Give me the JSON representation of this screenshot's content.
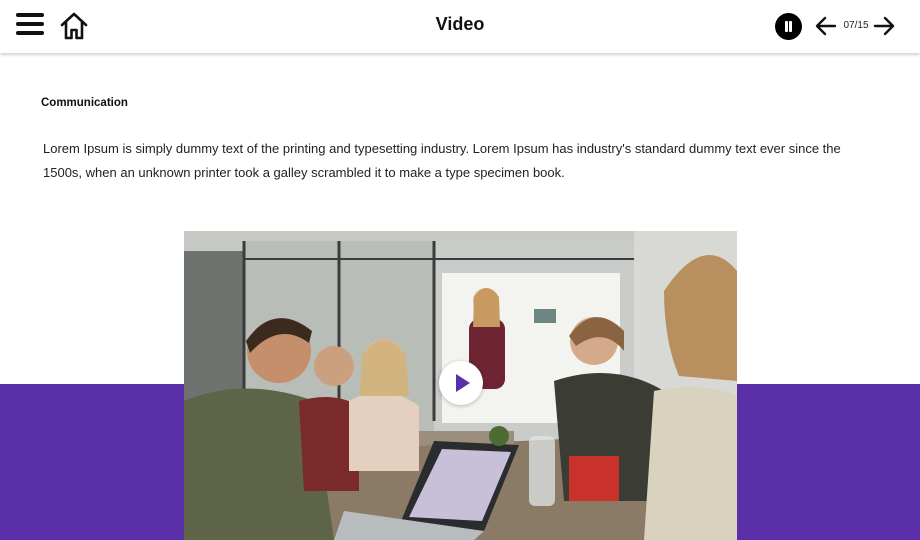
{
  "header": {
    "title": "Video",
    "page_counter": "07/15",
    "icons": {
      "menu": "hamburger-menu-icon",
      "home": "home-icon",
      "pause": "pause-icon",
      "prev": "arrow-left-icon",
      "next": "arrow-right-icon"
    }
  },
  "content": {
    "heading": "Communication",
    "paragraph": "Lorem Ipsum is simply dummy text of the printing and typesetting industry. Lorem Ipsum has industry's standard dummy text ever since the 1500s, when an unknown printer took a galley scrambled it to make a type specimen book."
  },
  "video": {
    "play_icon": "play-icon"
  },
  "colors": {
    "accent": "#5a2fa8",
    "header_bg": "#ffffff",
    "icon": "#111111"
  }
}
